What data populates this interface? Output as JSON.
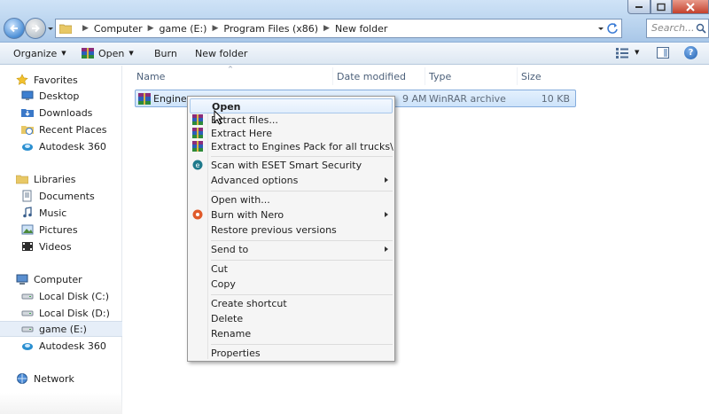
{
  "address": {
    "crumbs": [
      "Computer",
      "game (E:)",
      "Program Files (x86)",
      "New folder"
    ]
  },
  "search": {
    "placeholder": "Search..."
  },
  "toolbar": {
    "organize": "Organize",
    "open": "Open",
    "burn": "Burn",
    "new_folder": "New folder",
    "help": "?"
  },
  "navpane": {
    "favorites": {
      "label": "Favorites",
      "items": [
        "Desktop",
        "Downloads",
        "Recent Places",
        "Autodesk 360"
      ]
    },
    "libraries": {
      "label": "Libraries",
      "items": [
        "Documents",
        "Music",
        "Pictures",
        "Videos"
      ]
    },
    "computer": {
      "label": "Computer",
      "items": [
        "Local Disk (C:)",
        "Local Disk (D:)",
        "game (E:)",
        "Autodesk 360"
      ]
    },
    "network": {
      "label": "Network"
    }
  },
  "filelist": {
    "columns": [
      "Name",
      "Date modified",
      "Type",
      "Size"
    ],
    "rows": [
      {
        "name": "Engines",
        "date": "9 AM",
        "type": "WinRAR archive",
        "size": "10 KB"
      }
    ]
  },
  "context_menu": {
    "items": [
      {
        "label": "Open",
        "icon": ""
      },
      {
        "label": "Extract files...",
        "icon": "winrar-icon"
      },
      {
        "label": "Extract Here",
        "icon": "winrar-icon"
      },
      {
        "label": "Extract to Engines Pack for all trucks\\",
        "icon": "winrar-icon"
      },
      {
        "label": "Scan with ESET Smart Security",
        "icon": "eset-icon"
      },
      {
        "label": "Advanced options",
        "icon": ""
      },
      {
        "label": "Open with...",
        "icon": ""
      },
      {
        "label": "Burn with Nero",
        "icon": "nero-icon"
      },
      {
        "label": "Restore previous versions",
        "icon": ""
      },
      {
        "label": "Send to",
        "icon": ""
      },
      {
        "label": "Cut",
        "icon": ""
      },
      {
        "label": "Copy",
        "icon": ""
      },
      {
        "label": "Create shortcut",
        "icon": ""
      },
      {
        "label": "Delete",
        "icon": ""
      },
      {
        "label": "Rename",
        "icon": ""
      },
      {
        "label": "Properties",
        "icon": ""
      }
    ]
  },
  "colors": {
    "selection": "#cde3fa",
    "selection_border": "#84acdd",
    "menu_bg": "#f5f5f5",
    "titlebar": "#b9d3ee"
  }
}
